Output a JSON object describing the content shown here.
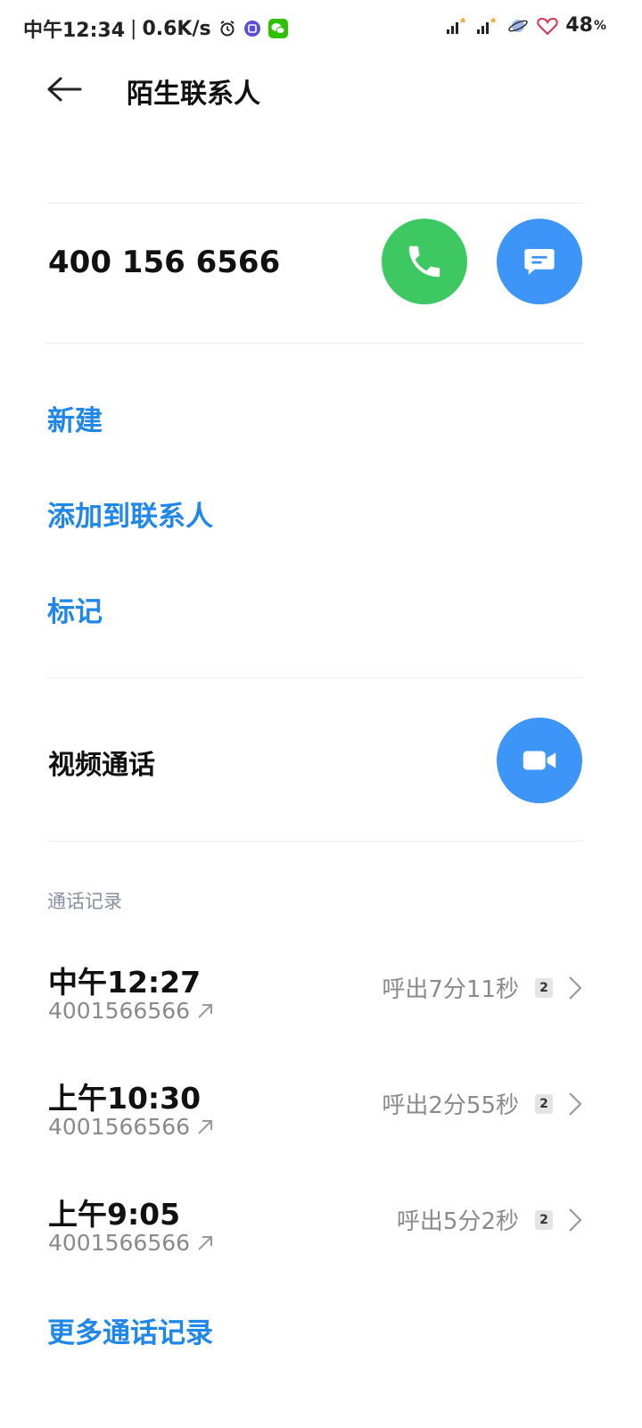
{
  "status_bar": {
    "time": "中午12:34",
    "separator": "|",
    "net_speed": "0.6K/s",
    "battery_percent": "48",
    "battery_unit": "%",
    "icons": [
      "alarm-icon",
      "tieba-icon",
      "wechat-icon",
      "signal-icon",
      "signal-icon",
      "planet-icon",
      "heart-icon"
    ]
  },
  "header": {
    "title": "陌生联系人"
  },
  "contact": {
    "number": "400 156 6566"
  },
  "actions": {
    "new": "新建",
    "add_to_contacts": "添加到联系人",
    "mark": "标记"
  },
  "video": {
    "label": "视频通话"
  },
  "call_log": {
    "section_title": "通话记录",
    "items": [
      {
        "time": "中午12:27",
        "number": "4001566566",
        "duration": "呼出7分11秒",
        "sim": "2"
      },
      {
        "time": "上午10:30",
        "number": "4001566566",
        "duration": "呼出2分55秒",
        "sim": "2"
      },
      {
        "time": "上午9:05",
        "number": "4001566566",
        "duration": "呼出5分2秒",
        "sim": "2"
      }
    ],
    "more": "更多通话记录"
  },
  "colors": {
    "accent": "#1f86ea",
    "call_green": "#3ec862",
    "button_blue": "#3d95f7",
    "secondary_text": "#8a8a8a"
  }
}
